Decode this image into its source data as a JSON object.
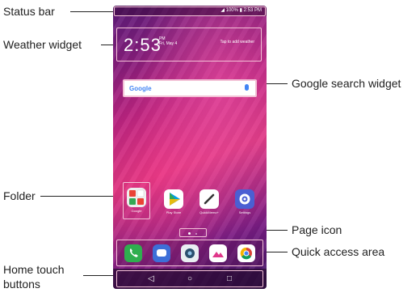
{
  "callouts": {
    "status_bar": "Status bar",
    "weather_widget": "Weather widget",
    "google_search_widget": "Google search widget",
    "folder": "Folder",
    "page_icon": "Page icon",
    "quick_access_area": "Quick access area",
    "home_touch_buttons_line1": "Home touch",
    "home_touch_buttons_line2": "buttons"
  },
  "status": {
    "battery": "100%",
    "time": "2:53 PM"
  },
  "weather": {
    "clock": "2:53",
    "ampm": "PM",
    "date": "Fri, May 4",
    "tap_text": "Tap to add weather"
  },
  "search": {
    "logo": "Google"
  },
  "apps": {
    "google_folder": "Google",
    "play_store": "Play Store",
    "quickmemo": "QuickMemo+",
    "settings": "Settings"
  },
  "nav": {
    "back": "◁",
    "home": "○",
    "recents": "□"
  },
  "colors": {
    "highlight": "#f3c1d6",
    "phone_icon": "#2fae4f",
    "messages_icon": "#3d6fd8",
    "settings_icon": "#4b5fd3"
  }
}
